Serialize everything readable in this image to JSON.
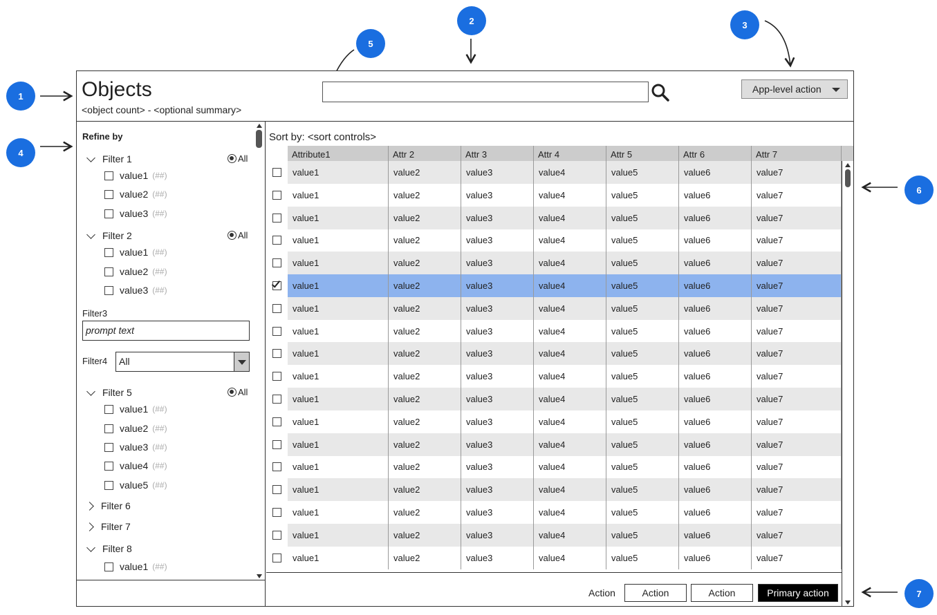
{
  "callouts": [
    "1",
    "2",
    "3",
    "4",
    "5",
    "6",
    "7"
  ],
  "header": {
    "title": "Objects",
    "summary": "<object count> - <optional summary>",
    "search_value": "",
    "app_action": "App-level action"
  },
  "sidebar": {
    "refine_label": "Refine by",
    "all_label": "All",
    "filters": [
      {
        "name": "Filter 1",
        "values": [
          {
            "label": "value1",
            "count": "(##)"
          },
          {
            "label": "value2",
            "count": "(##)"
          },
          {
            "label": "value3",
            "count": "(##)"
          }
        ]
      },
      {
        "name": "Filter 2",
        "values": [
          {
            "label": "value1",
            "count": "(##)"
          },
          {
            "label": "value2",
            "count": "(##)"
          },
          {
            "label": "value3",
            "count": "(##)"
          }
        ]
      },
      {
        "name": "Filter 5",
        "values": [
          {
            "label": "value1",
            "count": "(##)"
          },
          {
            "label": "value2",
            "count": "(##)"
          },
          {
            "label": "value3",
            "count": "(##)"
          },
          {
            "label": "value4",
            "count": "(##)"
          },
          {
            "label": "value5",
            "count": "(##)"
          }
        ]
      },
      {
        "name": "Filter 6"
      },
      {
        "name": "Filter 7"
      },
      {
        "name": "Filter 8",
        "values": [
          {
            "label": "value1",
            "count": "(##)"
          }
        ]
      }
    ],
    "filter3_label": "Filter3",
    "filter3_placeholder": "prompt text",
    "filter4_label": "Filter4",
    "filter4_value": "All"
  },
  "main": {
    "sort_label": "Sort by: <sort controls>",
    "columns": [
      "Attribute1",
      "Attr 2",
      "Attr 3",
      "Attr 4",
      "Attr 5",
      "Attr 6",
      "Attr 7"
    ],
    "row_values": [
      "value1",
      "value2",
      "value3",
      "value4",
      "value5",
      "value6",
      "value7"
    ],
    "row_count": 18,
    "selected_row": 5
  },
  "footer": {
    "label": "Action",
    "action1": "Action",
    "action2": "Action",
    "primary": "Primary action"
  }
}
